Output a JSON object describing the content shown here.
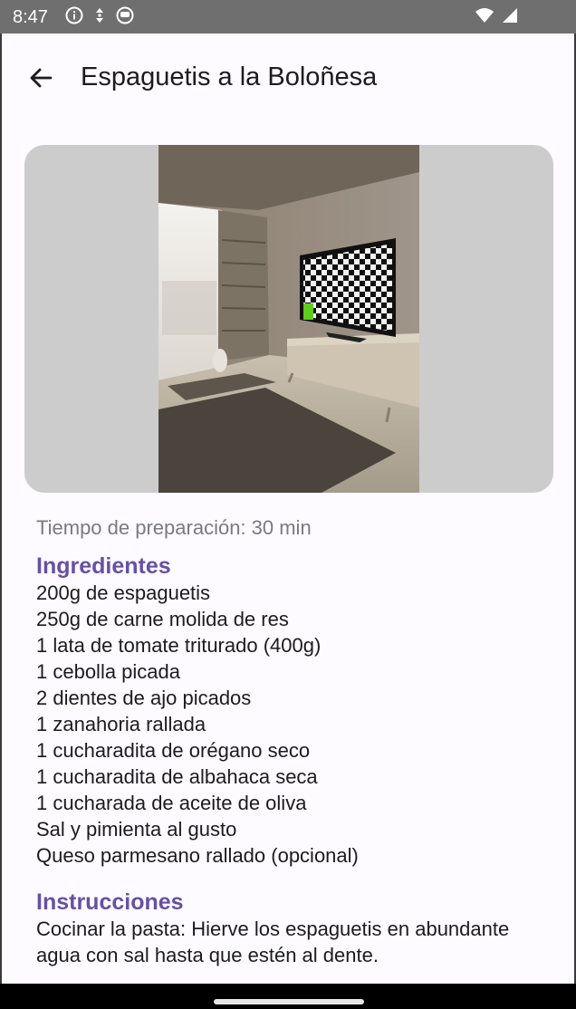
{
  "status_bar": {
    "time": "8:47",
    "left_icons": [
      "info-icon",
      "data-saver-icon",
      "app-icon"
    ],
    "right_icons": [
      "wifi-icon",
      "signal-icon"
    ]
  },
  "app_bar": {
    "back_icon": "arrow-back-icon",
    "title": "Espaguetis a la Boloñesa"
  },
  "recipe": {
    "prep_time": "Tiempo de preparación: 30 min",
    "ingredients_title": "Ingredientes",
    "ingredients": [
      "200g de espaguetis",
      "250g de carne molida de res",
      "1 lata de tomate triturado (400g)",
      "1 cebolla picada",
      "2 dientes de ajo picados",
      "1 zanahoria rallada",
      "1 cucharadita de orégano seco",
      "1 cucharadita de albahaca seca",
      "1 cucharada de aceite de oliva",
      "Sal y pimienta al gusto",
      "Queso parmesano rallado (opcional)"
    ],
    "instructions_title": "Instrucciones",
    "instructions_text": "Cocinar la pasta: Hierve los espaguetis en abundante agua con sal hasta que estén al dente."
  },
  "colors": {
    "accent": "#6750a4",
    "status_bar": "#6f6f6f",
    "background": "#fdfbff",
    "image_backdrop": "#cccccc"
  }
}
